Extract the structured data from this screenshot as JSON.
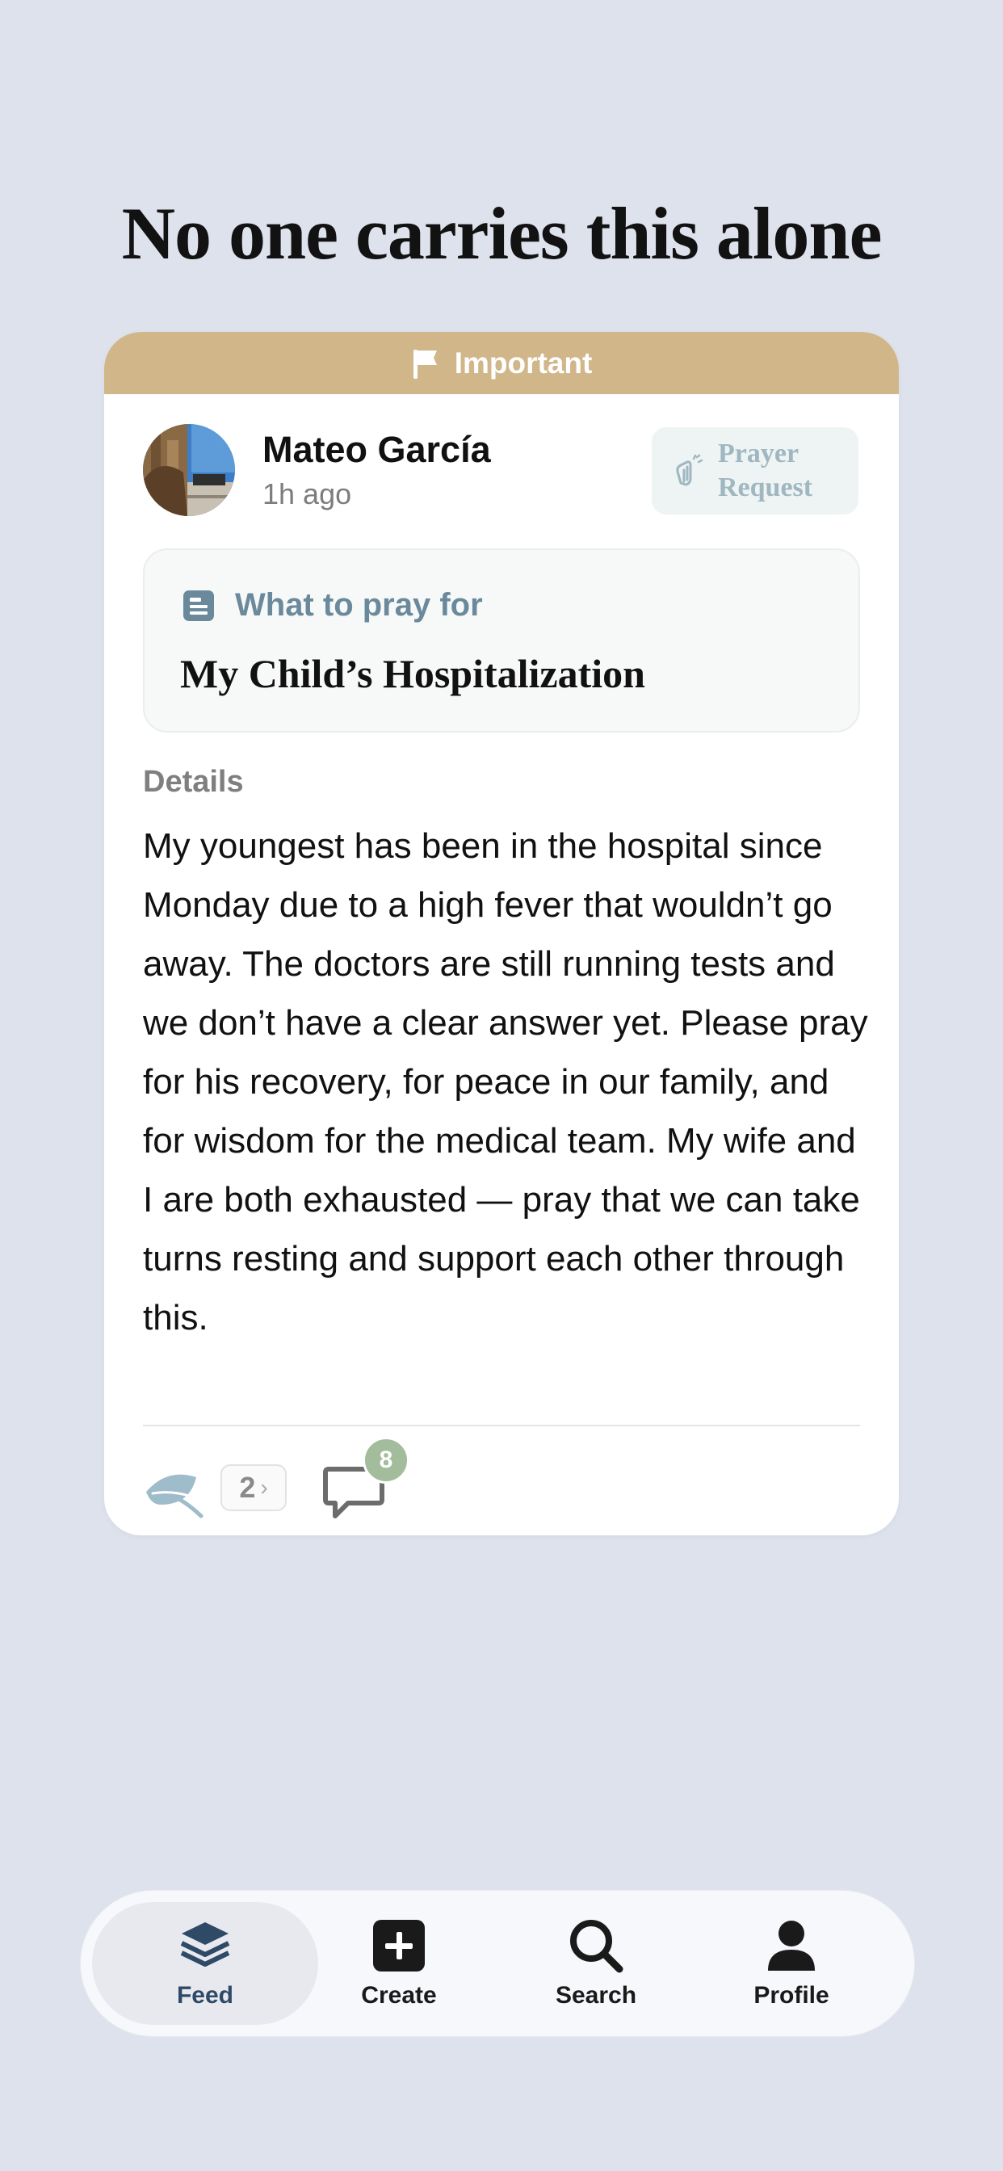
{
  "headline": "No one carries this alone",
  "post": {
    "banner_label": "Important",
    "author": "Mateo García",
    "time_ago": "1h ago",
    "tag_label": "Prayer Request",
    "pray_for_heading": "What to pray for",
    "pray_for_title": "My Child’s Hospitalization",
    "details_label": "Details",
    "details_text": "My youngest has been in the hospital since Monday due to a high fever that wouldn’t go away. The doctors are still running tests and we don’t have a clear answer yet. Please pray for his recovery, for peace in our family, and for wisdom for the medical team. My wife and I are both exhausted — pray that we can take turns resting and support each other through this.",
    "prayer_count": "2",
    "comment_count": "8"
  },
  "tabbar": {
    "items": [
      {
        "label": "Feed",
        "icon": "layers-icon",
        "active": true
      },
      {
        "label": "Create",
        "icon": "plus-square-icon",
        "active": false
      },
      {
        "label": "Search",
        "icon": "search-icon",
        "active": false
      },
      {
        "label": "Profile",
        "icon": "person-icon",
        "active": false
      }
    ]
  },
  "colors": {
    "background": "#dde2ec",
    "banner": "#d1b68a",
    "accent_blue": "#6a8a9c",
    "badge_green": "#a3bc9c"
  }
}
